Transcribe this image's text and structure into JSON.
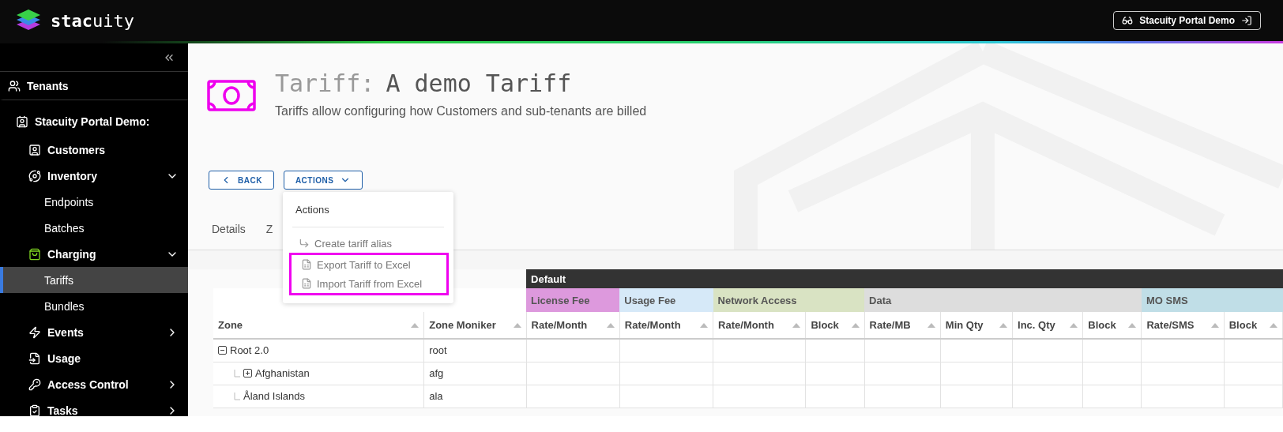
{
  "header": {
    "logo": "**stac**uity",
    "account_button": "Stacuity Portal Demo"
  },
  "sidebar": {
    "items": [
      {
        "label": "Tenants"
      },
      {
        "label": "Stacuity Portal Demo:",
        "children": [
          {
            "label": "Customers",
            "selected": false
          },
          {
            "label": "Inventory",
            "expanded": true,
            "children": [
              {
                "label": "Endpoints",
                "selected": false
              },
              {
                "label": "Batches",
                "selected": false
              }
            ]
          },
          {
            "label": "Charging",
            "expanded": true,
            "children": [
              {
                "label": "Tariffs",
                "selected": true
              },
              {
                "label": "Bundles",
                "selected": false
              }
            ]
          },
          {
            "label": "Events",
            "expanded": false
          },
          {
            "label": "Usage",
            "selected": false
          },
          {
            "label": "Access Control",
            "expanded": false
          },
          {
            "label": "Tasks",
            "expanded": false
          }
        ]
      }
    ]
  },
  "page": {
    "title_prefix": "Tariff:",
    "title": "A demo Tariff",
    "subtitle": "Tariffs allow configuring how Customers and sub-tenants are billed"
  },
  "buttons": [
    {
      "label": "BACK",
      "kind": "back"
    },
    {
      "label": "ACTIONS",
      "kind": "menu",
      "expanded": true
    }
  ],
  "actions_menu": {
    "title": "Actions",
    "items": [
      {
        "label": "Create tariff alias",
        "kind": "alias",
        "highlighted": false
      },
      {
        "label": "Export Tariff to Excel",
        "kind": "excel",
        "highlighted": true
      },
      {
        "label": "Import Tariff from Excel",
        "kind": "excel",
        "highlighted": true
      }
    ]
  },
  "tabs": [
    {
      "label": "Details",
      "selected": false
    },
    {
      "label": "Z",
      "selected": false
    }
  ],
  "table": {
    "band": "Default",
    "fixed_columns": [
      "Zone",
      "Zone Moniker"
    ],
    "groups": [
      {
        "label": "License Fee",
        "color": "#dd99dd",
        "columns": [
          "Rate/Month"
        ]
      },
      {
        "label": "Usage Fee",
        "color": "#d6e9f8",
        "columns": [
          "Rate/Month"
        ]
      },
      {
        "label": "Network Access",
        "color": "#d9e3c3",
        "columns": [
          "Rate/Month",
          "Block"
        ]
      },
      {
        "label": "Data",
        "color": "#dddddd",
        "columns": [
          "Rate/MB",
          "Min Qty",
          "Inc. Qty",
          "Block"
        ]
      },
      {
        "label": "MO SMS",
        "color": "#c0dee7",
        "columns": [
          "Rate/SMS",
          "Block"
        ]
      }
    ],
    "rows": [
      {
        "zone": "Root 2.0",
        "moniker": "root",
        "expanded": true,
        "children": [
          {
            "zone": "Afghanistan",
            "moniker": "afg",
            "expanded": false
          },
          {
            "zone": "Åland Islands",
            "moniker": "ala"
          }
        ]
      }
    ]
  }
}
